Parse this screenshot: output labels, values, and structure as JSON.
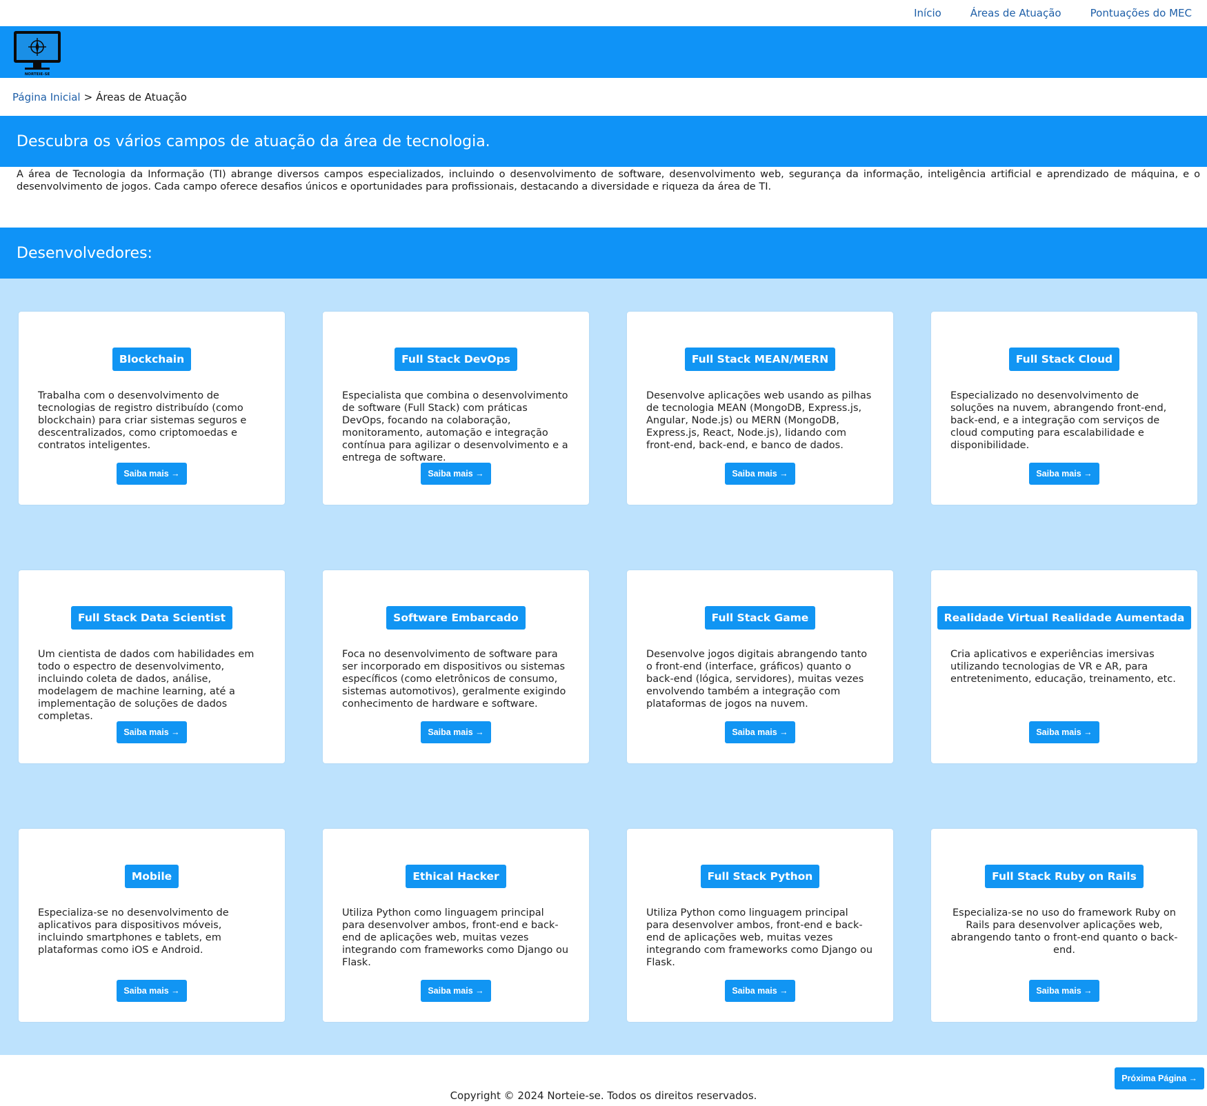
{
  "topnav": [
    "Início",
    "Áreas de Atuação",
    "Pontuações do MEC"
  ],
  "logo": {
    "text": "NORTEIE-SE"
  },
  "breadcrumb": {
    "home": "Página Inicial",
    "separator": ">",
    "current": "Áreas de Atuação"
  },
  "hero": {
    "title": "Descubra os vários campos de atuação da área de tecnologia.",
    "intro": "A área de Tecnologia da Informação (TI) abrange diversos campos especializados, incluindo o desenvolvimento de software, desenvolvimento web, segurança da informação, inteligência artificial e aprendizado de máquina, e o desenvolvimento de jogos. Cada campo oferece desafios únicos e oportunidades para profissionais, destacando a diversidade e riqueza da área de TI."
  },
  "section": {
    "title": "Desenvolvedores:"
  },
  "cards": [
    {
      "title": "Blockchain",
      "desc": "Trabalha com o desenvolvimento de tecnologias de registro distribuído (como blockchain) para criar sistemas seguros e descentralizados, como criptomoedas e contratos inteligentes.",
      "button": "Saiba mais →"
    },
    {
      "title": "Full Stack DevOps",
      "desc": "Especialista que combina o desenvolvimento de software (Full Stack) com práticas DevOps, focando na colaboração, monitoramento, automação e integração contínua para agilizar o desenvolvimento e a entrega de software.",
      "button": "Saiba mais →"
    },
    {
      "title": "Full Stack MEAN/MERN",
      "desc": "Desenvolve aplicações web usando as pilhas de tecnologia MEAN (MongoDB, Express.js, Angular, Node.js) ou MERN (MongoDB, Express.js, React, Node.js), lidando com front-end, back-end, e banco de dados.",
      "button": "Saiba mais →"
    },
    {
      "title": "Full Stack Cloud",
      "desc": "Especializado no desenvolvimento de soluções na nuvem, abrangendo front-end, back-end, e a integração com serviços de cloud computing para escalabilidade e disponibilidade.",
      "button": "Saiba mais →"
    },
    {
      "title": "Full Stack Data Scientist",
      "desc": "Um cientista de dados com habilidades em todo o espectro de desenvolvimento, incluindo coleta de dados, análise, modelagem de machine learning, até a implementação de soluções de dados completas.",
      "button": "Saiba mais →"
    },
    {
      "title": "Software Embarcado",
      "desc": "Foca no desenvolvimento de software para ser incorporado em dispositivos ou sistemas específicos (como eletrônicos de consumo, sistemas automotivos), geralmente exigindo conhecimento de hardware e software.",
      "button": "Saiba mais →"
    },
    {
      "title": "Full Stack Game",
      "desc": "Desenvolve jogos digitais abrangendo tanto o front-end (interface, gráficos) quanto o back-end (lógica, servidores), muitas vezes envolvendo também a integração com plataformas de jogos na nuvem.",
      "button": "Saiba mais →"
    },
    {
      "title": "Realidade Virtual Realidade Aumentada",
      "desc": "Cria aplicativos e experiências imersivas utilizando tecnologias de VR e AR, para entretenimento, educação, treinamento, etc.",
      "button": "Saiba mais →"
    },
    {
      "title": "Mobile",
      "desc": "Especializa-se no desenvolvimento de aplicativos para dispositivos móveis, incluindo smartphones e tablets, em plataformas como iOS e Android.",
      "button": "Saiba mais →"
    },
    {
      "title": "Ethical Hacker",
      "desc": "Utiliza Python como linguagem principal para desenvolver ambos, front-end e back-end de aplicações web, muitas vezes integrando com frameworks como Django ou Flask.",
      "button": "Saiba mais →"
    },
    {
      "title": "Full Stack Python",
      "desc": "Utiliza Python como linguagem principal para desenvolver ambos, front-end e back-end de aplicações web, muitas vezes integrando com frameworks como Django ou Flask.",
      "button": "Saiba mais →"
    },
    {
      "title": "Full Stack Ruby on Rails",
      "desc": "Especializa-se no uso do framework Ruby on Rails para desenvolver aplicações web, abrangendo tanto o front-end quanto o back-end.",
      "button": "Saiba mais →"
    }
  ],
  "next_button": "Próxima Página →",
  "footer": "Copyright © 2024 Norteie-se. Todos os direitos reservados."
}
